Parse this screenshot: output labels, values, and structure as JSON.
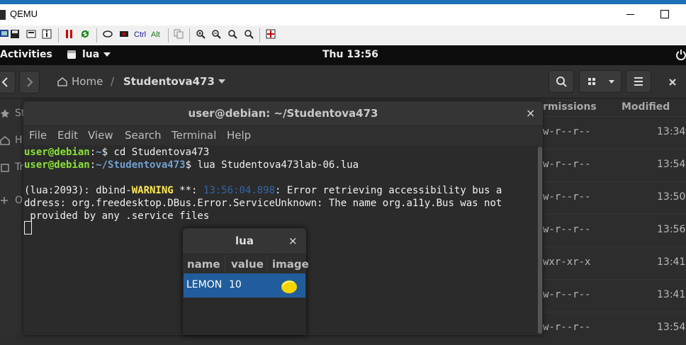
{
  "qemu": {
    "title": "QEMU",
    "toolbar": {
      "ctrl_label": "Ctrl",
      "alt_label": "Alt"
    }
  },
  "gnome": {
    "activities": "Activities",
    "app_name": "lua",
    "clock": "Thu 13:56"
  },
  "nautilus": {
    "path_home": "Home",
    "path_separator": "/",
    "path_current": "Studentova473",
    "sidebar_partial": [
      "St",
      "H",
      "Tr",
      "O"
    ],
    "col_permissions": "rmissions",
    "col_modified": "Modified",
    "rows": [
      {
        "perm": "w-r--r--",
        "modified": "13:34"
      },
      {
        "perm": "w-r--r--",
        "modified": "13:54"
      },
      {
        "perm": "w-r--r--",
        "modified": "13:50"
      },
      {
        "perm": "w-r--r--",
        "modified": "13:56"
      },
      {
        "perm": "wxr-xr-x",
        "modified": "13:41"
      },
      {
        "perm": "w-r--r--",
        "modified": "13:41"
      },
      {
        "perm": "w-r--r--",
        "modified": "13:54"
      }
    ]
  },
  "terminal": {
    "title": "user@debian: ~/Studentova473",
    "close": "×",
    "menu": [
      "File",
      "Edit",
      "View",
      "Search",
      "Terminal",
      "Help"
    ],
    "lines": {
      "l1_user": "user@debian",
      "l1_colon": ":",
      "l1_path": "~",
      "l1_cmd": "$ cd Studentova473",
      "l2_user": "user@debian",
      "l2_colon": ":",
      "l2_path": "~/Studentova473",
      "l2_cmd": "$ lua Studentova473lab-06.lua",
      "l3_pre": "(lua:2093): dbind-",
      "l3_warn": "WARNING",
      "l3_mid": " **: ",
      "l3_time": "13:56:04.898",
      "l3_post": ": Error retrieving accessibility bus a",
      "l4": "ddress: org.freedesktop.DBus.Error.ServiceUnknown: The name org.a11y.Bus was not",
      "l5": " provided by any .service files"
    }
  },
  "lua_window": {
    "title": "lua",
    "close": "×",
    "columns": [
      "name",
      "value",
      "image"
    ],
    "row": {
      "name": "LEMON",
      "value": "10",
      "image_icon": "lemon-icon"
    }
  },
  "colors": {
    "prompt_green": "#8ae234",
    "path_blue": "#729fcf",
    "warning_yellow": "#fce94f",
    "selection_blue": "#215d9c"
  }
}
